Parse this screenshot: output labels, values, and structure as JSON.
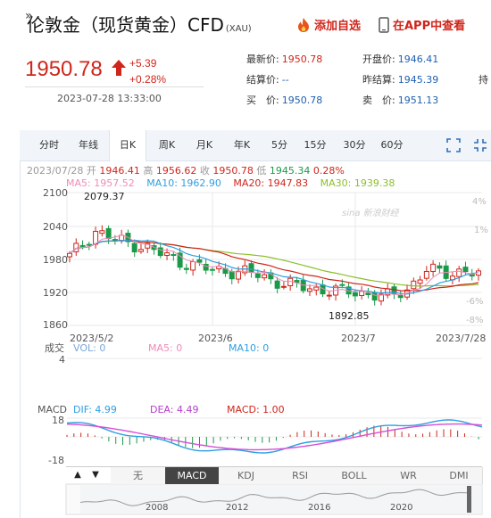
{
  "header": {
    "title": "伦敦金（现货黄金）CFD",
    "title_sub": "(XAU)",
    "title_mark": "»",
    "watch_label": "添加自选",
    "app_label": "在APP中查看",
    "price": "1950.78",
    "change": "+5.39",
    "change_pct": "+0.28%",
    "datetime": "2023-07-28 13:33:00",
    "up_color": "#d0251b"
  },
  "quote": {
    "latest_label": "最新价:",
    "latest": "1950.78",
    "open_label": "开盘价:",
    "open": "1946.41",
    "settle_label": "结算价:",
    "settle": "--",
    "prev_settle_label": "昨结算:",
    "prev_settle": "1945.39",
    "buy_label": "买　价:",
    "buy": "1950.78",
    "sell_label": "卖　价:",
    "sell": "1951.13",
    "hold_label": "持"
  },
  "tabs": [
    "分时",
    "年线",
    "日K",
    "周K",
    "月K",
    "年K",
    "5分",
    "15分",
    "30分",
    "60分"
  ],
  "active_tab": "日K",
  "info": {
    "date": "2023/07/28",
    "open_label": "开",
    "open": "1946.41",
    "high_label": "高",
    "high": "1956.62",
    "close_label": "收",
    "close": "1950.78",
    "low_label": "低",
    "low": "1945.34",
    "pct": "0.28%"
  },
  "ma": {
    "ma5": "MA5: 1957.52",
    "ma10": "MA10: 1962.90",
    "ma20": "MA20: 1947.83",
    "ma30": "MA30: 1939.38",
    "c_ma5": "#f08ab8",
    "c_ma10": "#2f9fe0",
    "c_ma20": "#d0251b",
    "c_ma30": "#8cbf2a"
  },
  "price_axis": {
    "labels": [
      "2100",
      "2040",
      "1980",
      "1920",
      "1860"
    ],
    "pct_labels": [
      "4%",
      "1%",
      "-6%",
      "-8%"
    ]
  },
  "annotations": {
    "high": "2079.37",
    "low": "1892.85",
    "watermark": "sina 新浪财经"
  },
  "dates": [
    "2023/5/2",
    "2023/6",
    "2023/7",
    "2023/7/28"
  ],
  "volume": {
    "label": "成交",
    "vol": "VOL: 0",
    "ma5": "MA5: 0",
    "ma10": "MA10: 0",
    "tick": "4"
  },
  "macd": {
    "title": "MACD",
    "dif": "DIF: 4.99",
    "dea": "DEA: 4.49",
    "macd": "MACD: 1.00",
    "top": "18",
    "bottom": "-18"
  },
  "indicator_tabs": [
    "无",
    "MACD",
    "KDJ",
    "RSI",
    "BOLL",
    "WR",
    "DMI"
  ],
  "active_indicator": "MACD",
  "overview_years": [
    "2008",
    "2012",
    "2016",
    "2020"
  ]
}
